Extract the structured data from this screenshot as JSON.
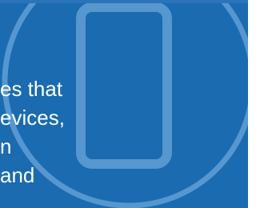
{
  "feature": {
    "icon": "smartphone-icon",
    "colors": {
      "background": "#1a6bb0",
      "accent_strip": "#2b74ba",
      "emblem_stroke": "#6aa6d8",
      "text": "#ffffff"
    },
    "text_lines": [
      "es that",
      "evices,",
      "n",
      "and"
    ]
  }
}
